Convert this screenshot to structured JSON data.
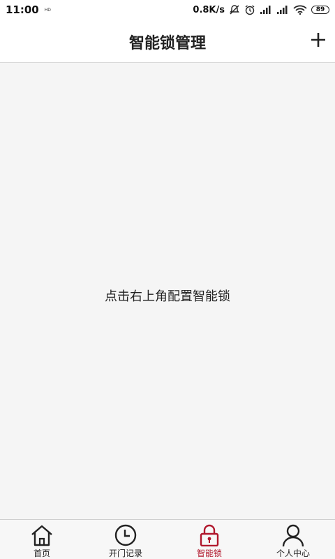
{
  "status_bar": {
    "time": "11:00",
    "carrier_text": "HD",
    "network_speed": "0.8K/s",
    "battery_level": "89"
  },
  "header": {
    "title": "智能锁管理"
  },
  "main": {
    "empty_hint": "点击右上角配置智能锁"
  },
  "tabbar": {
    "active_color": "#b0162b",
    "tabs": [
      {
        "label": "首页",
        "icon": "home-icon"
      },
      {
        "label": "开门记录",
        "icon": "clock-icon"
      },
      {
        "label": "智能锁",
        "icon": "lock-icon"
      },
      {
        "label": "个人中心",
        "icon": "person-icon"
      }
    ]
  }
}
